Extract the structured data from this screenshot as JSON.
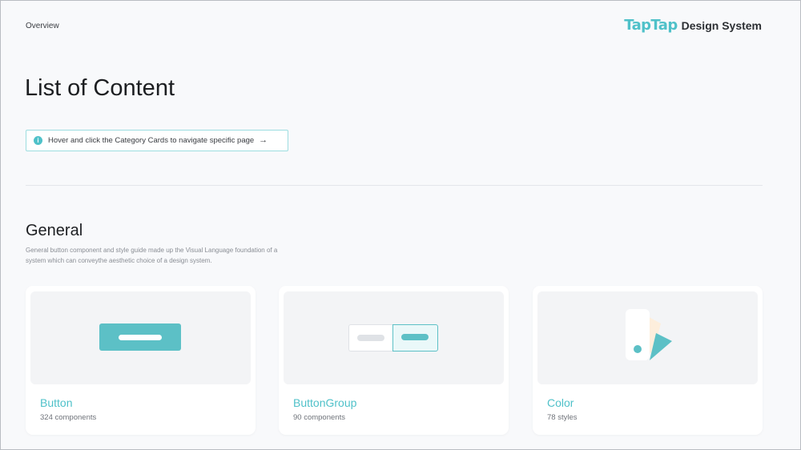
{
  "header": {
    "breadcrumb": "Overview",
    "brand_logo": "TapTap",
    "brand_name": "Design System"
  },
  "page": {
    "title": "List of Content",
    "notice": {
      "icon": "info-icon",
      "text": "Hover and click the Category Cards to navigate specific page",
      "arrow": "→"
    }
  },
  "section": {
    "title": "General",
    "description": "General button component and style guide made up the Visual Language foundation of a system which can conveythe aesthetic choice of a design system."
  },
  "cards": [
    {
      "title": "Button",
      "subtitle": "324 components",
      "icon": "button-illustration"
    },
    {
      "title": "ButtonGroup",
      "subtitle": "90 components",
      "icon": "button-group-illustration"
    },
    {
      "title": "Color",
      "subtitle": "78 styles",
      "icon": "color-swatch-illustration"
    }
  ],
  "colors": {
    "accent": "#4fc1c9",
    "background": "#f8f9fb",
    "card": "#ffffff",
    "swatch_peach": "#fdeedc"
  }
}
